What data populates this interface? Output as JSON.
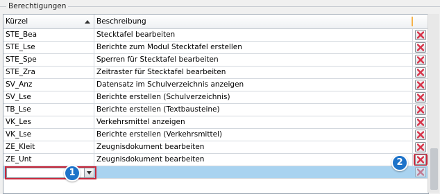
{
  "group": {
    "title": "Berechtigungen"
  },
  "header": {
    "kuerzel": "Kürzel",
    "beschreibung": "Beschreibung"
  },
  "rows": [
    {
      "kuerzel": "STE_Bea",
      "beschreibung": "Stecktafel bearbeiten"
    },
    {
      "kuerzel": "STE_Lse",
      "beschreibung": "Berichte zum Modul Stecktafel erstellen"
    },
    {
      "kuerzel": "STE_Spe",
      "beschreibung": "Sperren für Stecktafel bearbeiten"
    },
    {
      "kuerzel": "STE_Zra",
      "beschreibung": "Zeitraster für Stecktafel bearbeiten"
    },
    {
      "kuerzel": "SV_Anz",
      "beschreibung": "Datensatz im Schulverzeichnis anzeigen"
    },
    {
      "kuerzel": "SV_Lse",
      "beschreibung": "Berichte erstellen (Schulverzeichnis)"
    },
    {
      "kuerzel": "TB_Lse",
      "beschreibung": "Berichte erstellen (Textbausteine)"
    },
    {
      "kuerzel": "VK_Les",
      "beschreibung": "Verkehrsmittel anzeigen"
    },
    {
      "kuerzel": "VK_Lse",
      "beschreibung": "Berichte erstellen (Verkehrsmittel)"
    },
    {
      "kuerzel": "ZE_Kleit",
      "beschreibung": "Zeugnisdokument bearbeiten"
    },
    {
      "kuerzel": "ZE_Unt",
      "beschreibung": "Zeugnisdokument bearbeiten"
    }
  ],
  "new_row": {
    "kuerzel_value": ""
  },
  "callouts": {
    "one": "1",
    "two": "2"
  },
  "icons": {
    "delete": "close-icon",
    "sort": "sort-ascending-icon",
    "dropdown": "chevron-down-icon"
  },
  "colors": {
    "delete_red": "#d8344a",
    "selection_blue": "#a9d3f0",
    "callout_blue": "#1d73c9",
    "highlight_red": "#c8283c"
  }
}
